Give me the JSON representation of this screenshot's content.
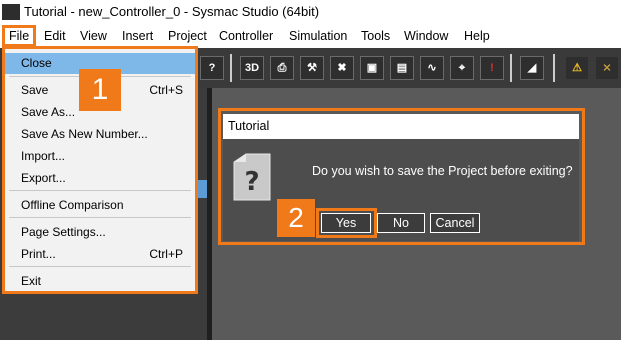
{
  "window": {
    "title": "Tutorial - new_Controller_0 - Sysmac Studio (64bit)"
  },
  "menubar": {
    "items": [
      "File",
      "Edit",
      "View",
      "Insert",
      "Project",
      "Controller",
      "Simulation",
      "Tools",
      "Window",
      "Help"
    ]
  },
  "toolbar": {
    "icons": [
      "help-icon",
      "3d-view-icon",
      "transfer-icon",
      "build-icon",
      "cross-reference-icon",
      "watch-icon",
      "data-trace-icon",
      "oscilloscope-icon",
      "search-icon",
      "alarm-icon",
      "filter-icon",
      "warning-icon",
      "offline-icon"
    ],
    "label_3d": "3D"
  },
  "file_menu": {
    "items": [
      {
        "label": "Close",
        "shortcut": ""
      },
      {
        "label": "Save",
        "shortcut": "Ctrl+S"
      },
      {
        "label": "Save As...",
        "shortcut": ""
      },
      {
        "label": "Save As New Number...",
        "shortcut": ""
      },
      {
        "label": "Import...",
        "shortcut": ""
      },
      {
        "label": "Export...",
        "shortcut": ""
      },
      {
        "label": "Offline Comparison",
        "shortcut": ""
      },
      {
        "label": "Page Settings...",
        "shortcut": ""
      },
      {
        "label": "Print...",
        "shortcut": "Ctrl+P"
      },
      {
        "label": "Exit",
        "shortcut": ""
      }
    ]
  },
  "steps": {
    "step1": "1",
    "step2": "2"
  },
  "dialog": {
    "title": "Tutorial",
    "icon": "question-document-icon",
    "message": "Do you wish to save the Project before exiting?",
    "buttons": {
      "yes": "Yes",
      "no": "No",
      "cancel": "Cancel"
    }
  },
  "colors": {
    "highlight": "#f07a1a",
    "selection": "#7eb8e8",
    "toolbar_bg": "#3a3a3a",
    "dialog_bg": "#4d4d4d"
  }
}
